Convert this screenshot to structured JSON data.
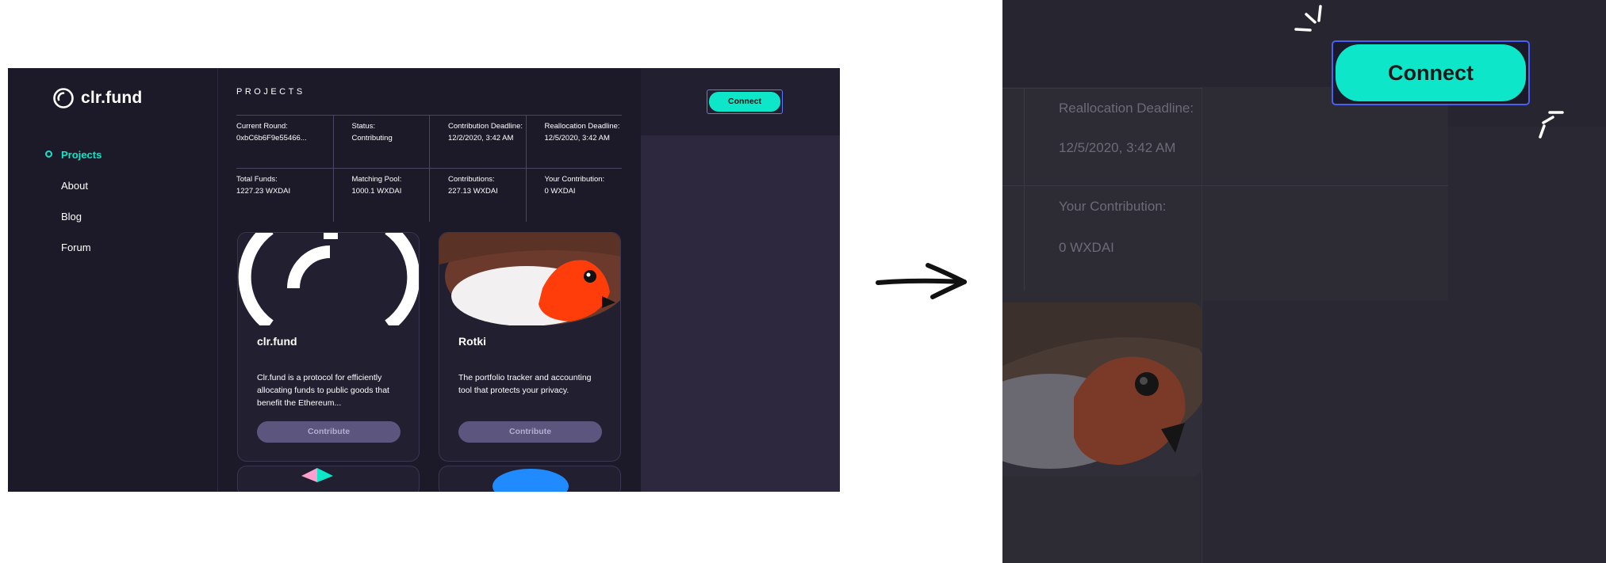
{
  "app": {
    "logo_text": "clr.fund",
    "nav": [
      {
        "label": "Projects",
        "active": true
      },
      {
        "label": "About",
        "active": false
      },
      {
        "label": "Blog",
        "active": false
      },
      {
        "label": "Forum",
        "active": false
      }
    ],
    "page_title": "PROJECTS",
    "round_info": [
      {
        "label": "Current Round:",
        "value": "0xbC6b6F9e55466..."
      },
      {
        "label": "Status:",
        "value": "Contributing"
      },
      {
        "label": "Contribution Deadline:",
        "value": "12/2/2020, 3:42 AM"
      },
      {
        "label": "Reallocation Deadline:",
        "value": "12/5/2020, 3:42 AM"
      },
      {
        "label": "Total Funds:",
        "value": "1227.23 WXDAI"
      },
      {
        "label": "Matching Pool:",
        "value": "1000.1 WXDAI"
      },
      {
        "label": "Contributions:",
        "value": "227.13 WXDAI"
      },
      {
        "label": "Your Contribution:",
        "value": "0 WXDAI"
      }
    ],
    "projects": [
      {
        "name": "clr.fund",
        "description": "Clr.fund is a protocol for efficiently allocating funds to public goods that benefit the Ethereum...",
        "button": "Contribute"
      },
      {
        "name": "Rotki",
        "description": "The portfolio tracker and accounting tool that protects your privacy.",
        "button": "Contribute"
      }
    ],
    "connect_label": "Connect"
  },
  "zoom": {
    "reallocation_label": "Reallocation Deadline:",
    "reallocation_value": "12/5/2020, 3:42 AM",
    "your_contribution_label": "Your Contribution:",
    "your_contribution_value": "0 WXDAI",
    "connect_label": "Connect"
  },
  "colors": {
    "accent": "#0ee6c9",
    "background": "#1c1a29",
    "button_disabled": "#5c567e",
    "connect_border": "#4b60f0"
  }
}
